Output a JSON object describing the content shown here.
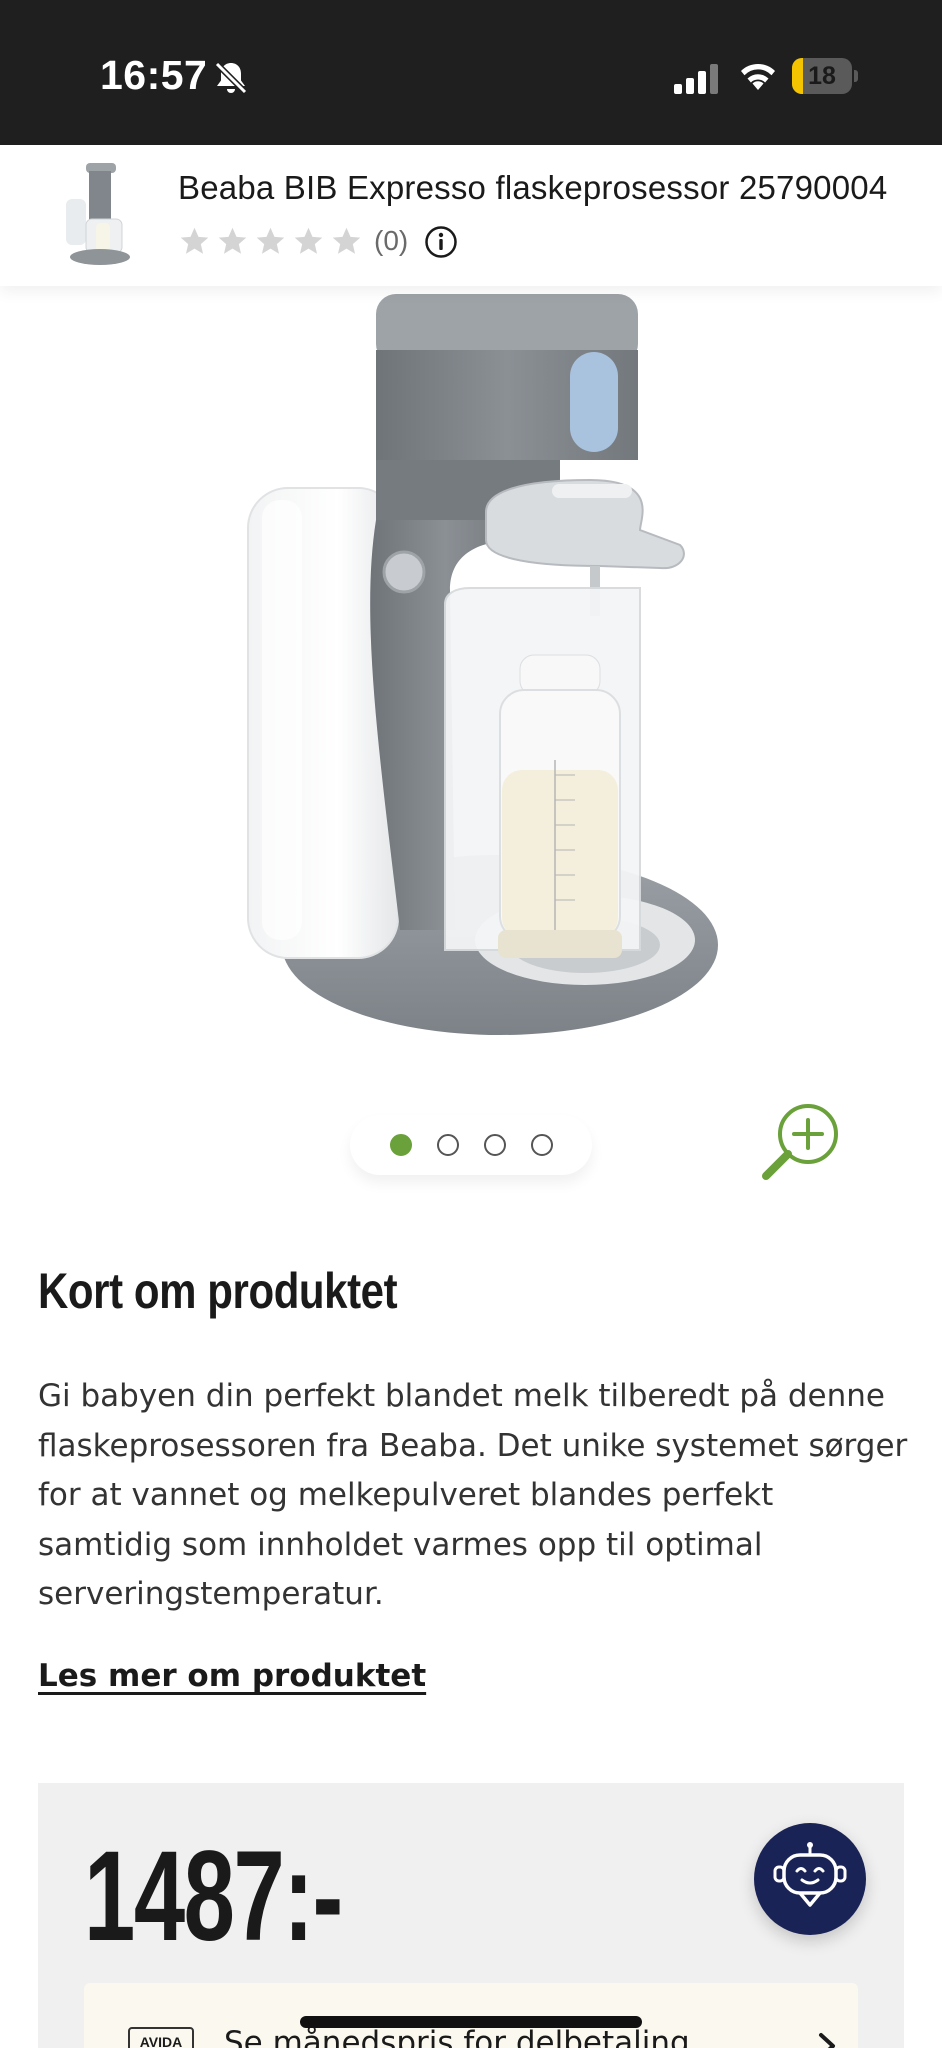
{
  "status_bar": {
    "time": "16:57",
    "battery_level": "18",
    "battery_fraction": 0.18,
    "icons": [
      "bell-slash-icon",
      "cellular-signal-icon",
      "wifi-icon",
      "battery-icon"
    ]
  },
  "product_header": {
    "title": "Beaba BIB Expresso flaskeprosessor 25790004",
    "rating_count": "(0)",
    "stars_filled": 0,
    "stars_total": 5,
    "icons": [
      "product-thumbnail",
      "star-icon",
      "info-icon"
    ]
  },
  "gallery": {
    "image_count": 4,
    "active_index": 0,
    "accent_color": "#6aa13a",
    "icons": [
      "zoom-in-icon"
    ]
  },
  "description": {
    "heading": "Kort om produktet",
    "body": "Gi babyen din perfekt blandet melk tilberedt på denne flaskeprosessoren fra Beaba. Det unike systemet sørger for at vannet og melkepulveret blandes perfekt samtidig som innholdet varmes opp til optimal serveringstemperatur.",
    "read_more": "Les mer om produktet"
  },
  "price_box": {
    "price": "1487:-",
    "chatbot_color": "#1a2356",
    "finance_logo": "AVIDA",
    "finance_text": "Se månedspris for delbetaling",
    "icons": [
      "chatbot-icon",
      "chevron-right-icon"
    ]
  }
}
